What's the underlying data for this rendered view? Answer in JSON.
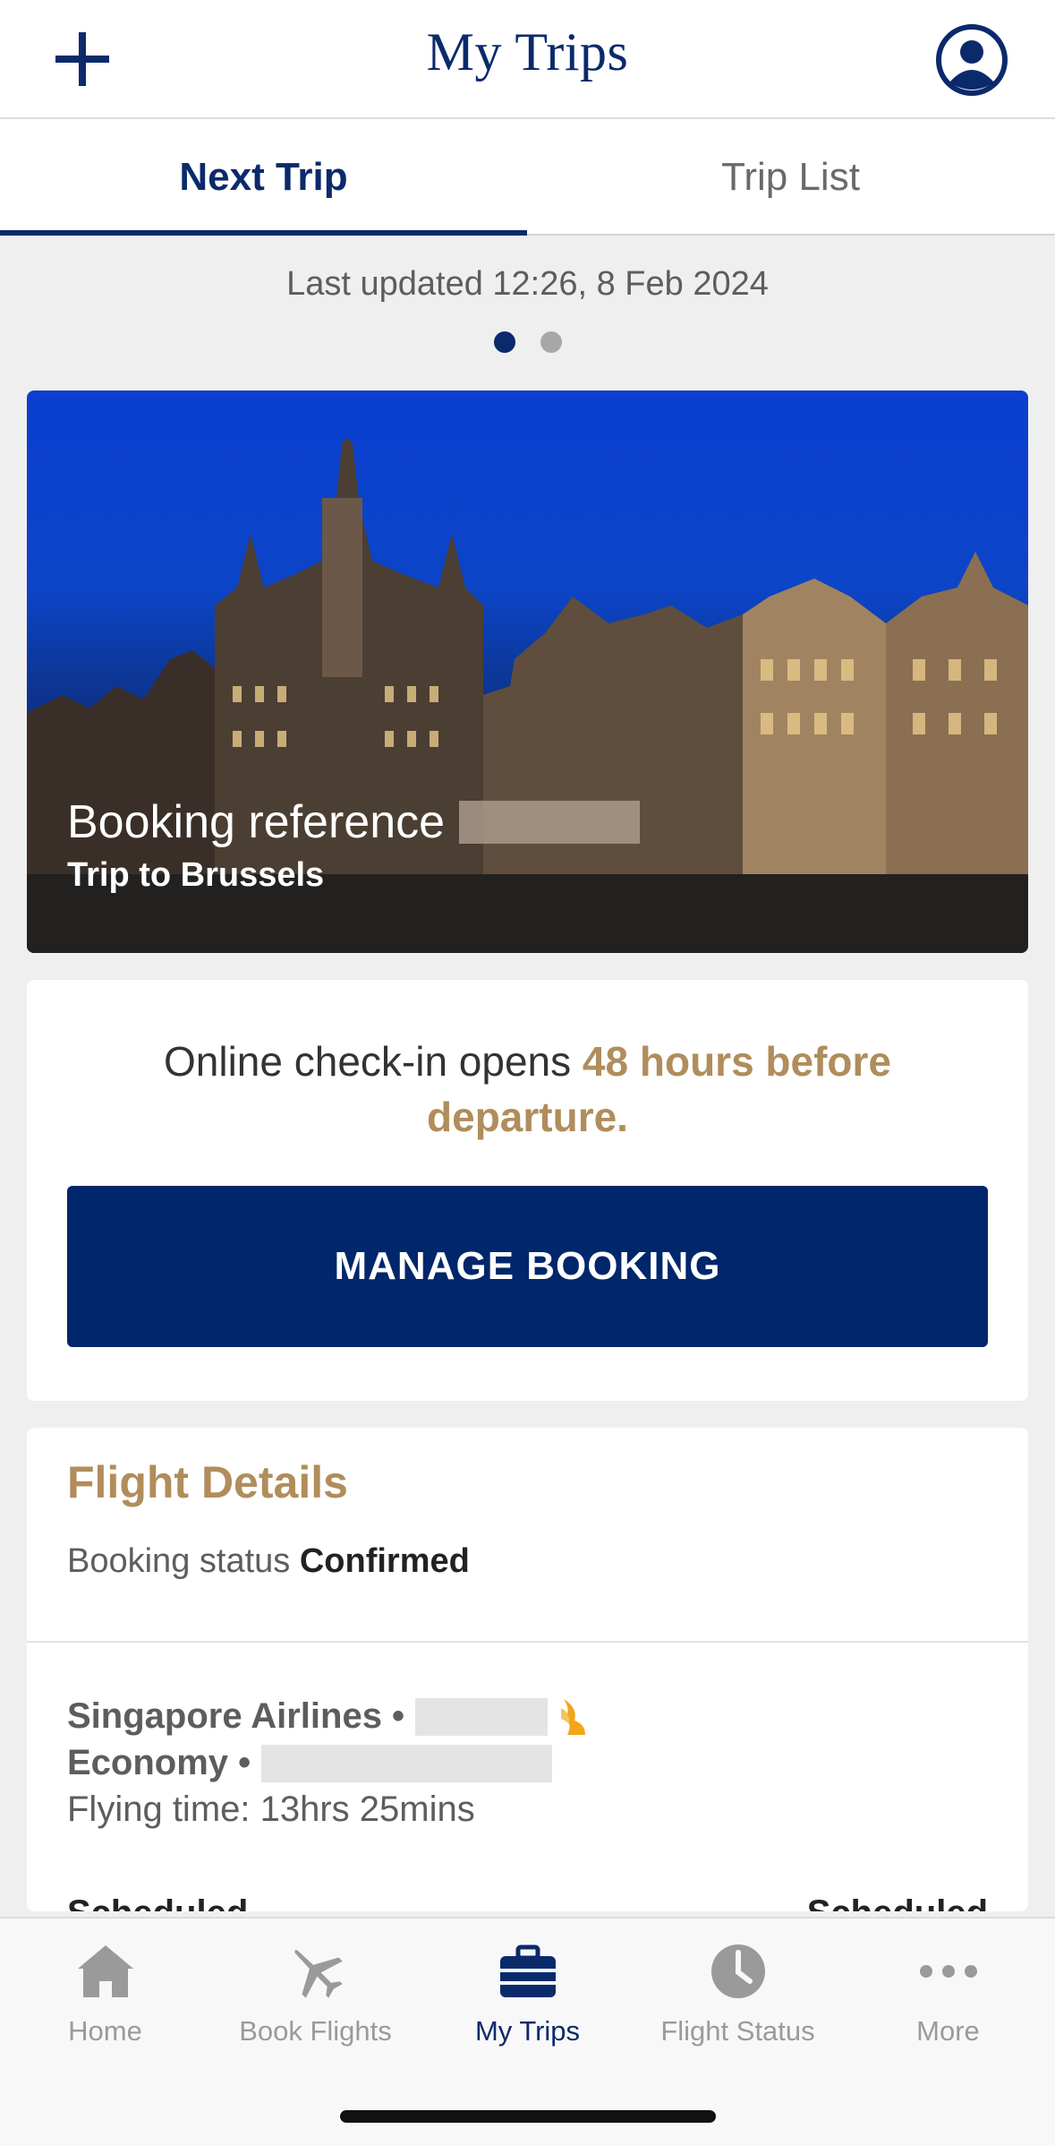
{
  "header": {
    "title": "My Trips",
    "add_icon": "plus-icon",
    "profile_icon": "user-circle-icon"
  },
  "tabs": [
    {
      "label": "Next Trip",
      "active": true
    },
    {
      "label": "Trip List",
      "active": false
    }
  ],
  "last_updated": "Last updated 12:26, 8 Feb 2024",
  "pager": {
    "current": 1,
    "total": 2
  },
  "hero": {
    "booking_ref_label": "Booking reference",
    "trip_name": "Trip to Brussels"
  },
  "checkin": {
    "text_prefix": "Online check-in opens ",
    "text_highlight": "48 hours before departure.",
    "manage_label": "MANAGE BOOKING"
  },
  "flight_details": {
    "title": "Flight Details",
    "status_label": "Booking status",
    "status_value": "Confirmed",
    "airline": "Singapore Airlines •",
    "airline_logo_icon": "singapore-airlines-bird-icon",
    "cabin": "Economy •",
    "flying_time": "Flying time: 13hrs 25mins",
    "departure_status": "Scheduled",
    "arrival_status": "Scheduled"
  },
  "bottom_nav": [
    {
      "label": "Home",
      "icon": "home-icon",
      "active": false
    },
    {
      "label": "Book Flights",
      "icon": "airplane-icon",
      "active": false
    },
    {
      "label": "My Trips",
      "icon": "suitcase-icon",
      "active": true
    },
    {
      "label": "Flight Status",
      "icon": "clock-icon",
      "active": false
    },
    {
      "label": "More",
      "icon": "more-dots-icon",
      "active": false
    }
  ],
  "colors": {
    "brand_navy": "#0b2a6b",
    "button_navy": "#00266b",
    "gold": "#b08d5b",
    "wing_orange": "#f2a618"
  }
}
